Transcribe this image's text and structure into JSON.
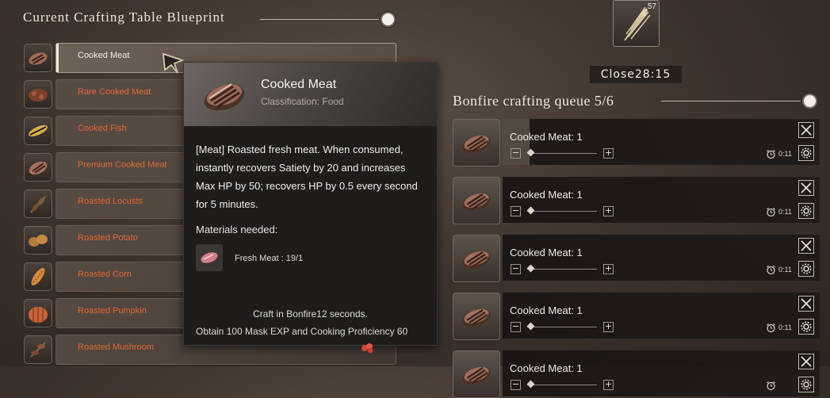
{
  "blueprint": {
    "title": "Current Crafting Table Blueprint",
    "recipes": [
      {
        "label": "Cooked Meat",
        "icon": "cooked-meat-icon",
        "selected": true
      },
      {
        "label": "Rare Cooked Meat",
        "icon": "rare-cooked-meat-icon"
      },
      {
        "label": "Cooked Fish",
        "icon": "cooked-fish-icon"
      },
      {
        "label": "Premium Cooked Meat",
        "icon": "premium-cooked-meat-icon"
      },
      {
        "label": "Roasted Locusts",
        "icon": "roasted-locusts-icon"
      },
      {
        "label": "Roasted Potato",
        "icon": "roasted-potato-icon"
      },
      {
        "label": "Roasted Corn",
        "icon": "roasted-corn-icon"
      },
      {
        "label": "Roasted Pumpkin",
        "icon": "roasted-pumpkin-icon"
      },
      {
        "label": "Roasted Mushroom",
        "icon": "roasted-mushroom-icon"
      }
    ]
  },
  "tooltip": {
    "name": "Cooked Meat",
    "classification": "Classification: Food",
    "description": "[Meat] Roasted fresh meat. When consumed, instantly recovers Satiety by 20 and increases Max HP by 50; recovers HP by 0.5 every second for 5 minutes.",
    "materials_heading": "Materials needed:",
    "material": "Fresh Meat : 19/1",
    "craft_info": "Craft in Bonfire12 seconds.",
    "reward": "Obtain 100 Mask EXP   and   Cooking Proficiency 60"
  },
  "resource": {
    "count": "57",
    "icon": "wheat-icon"
  },
  "close_timer": "Close28:15",
  "queue": {
    "title": "Bonfire crafting queue 5/6",
    "items": [
      {
        "label": "Cooked Meat: 1",
        "time": "0:11"
      },
      {
        "label": "Cooked Meat: 1",
        "time": "0:11"
      },
      {
        "label": "Cooked Meat: 1",
        "time": "0:11"
      },
      {
        "label": "Cooked Meat: 1",
        "time": "0:11"
      },
      {
        "label": "Cooked Meat: 1",
        "time": ""
      }
    ]
  },
  "colors": {
    "recipe_text": "#e06a3c",
    "selected_text": "#f1ece4"
  }
}
